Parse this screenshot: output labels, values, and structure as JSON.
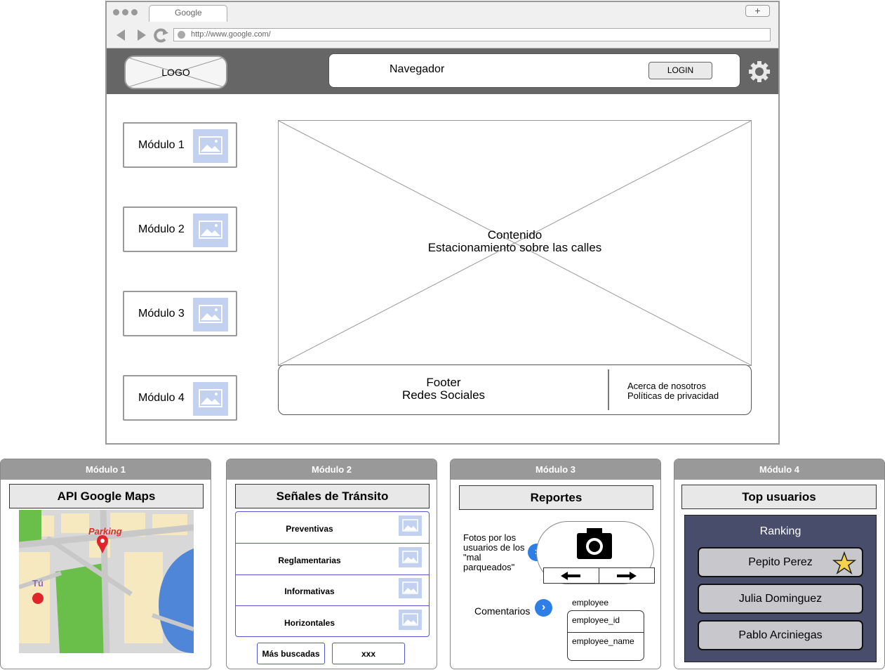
{
  "browser": {
    "tab_title": "Google",
    "new_tab_symbol": "+",
    "url": "http://www.google.com/"
  },
  "header": {
    "logo": "LOGO",
    "nav_label": "Navegador",
    "login_label": "LOGIN"
  },
  "sidebar": {
    "items": [
      {
        "label": "Módulo 1"
      },
      {
        "label": "Módulo 2"
      },
      {
        "label": "Módulo 3"
      },
      {
        "label": "Módulo 4"
      }
    ]
  },
  "content": {
    "line1": "Contenido",
    "line2": "Estacionamiento sobre las calles"
  },
  "footer": {
    "line1": "Footer",
    "line2": "Redes Sociales",
    "link1": "Acerca de nosotros",
    "link2": "Políticas de privacidad"
  },
  "modules": {
    "m1": {
      "title": "Módulo 1",
      "heading": "API Google Maps",
      "parking": "Parking",
      "you": "Tú"
    },
    "m2": {
      "title": "Módulo 2",
      "heading": "Señales de Tránsito",
      "items": [
        "Preventivas",
        "Reglamentarias",
        "Informativas",
        "Horizontales"
      ],
      "btn1": "Más buscadas",
      "btn2": "xxx"
    },
    "m3": {
      "title": "Módulo 3",
      "heading": "Reportes",
      "photos_line1": "Fotos por los",
      "photos_line2": "usuarios de los",
      "photos_line3": "\"mal",
      "photos_line4": "parqueados\"",
      "comments": "Comentarios",
      "table_name": "employee",
      "field1": "employee_id",
      "field2": "employee_name"
    },
    "m4": {
      "title": "Módulo 4",
      "heading": "Top usuarios",
      "ranking": "Ranking",
      "users": [
        "Pepito Perez",
        "Julia Dominguez",
        "Pablo Arciniegas"
      ]
    }
  },
  "colors": {
    "header_bg": "#666666",
    "panel_title_bg": "#999999",
    "image_placeholder": "#c2d1ef",
    "accent_blue": "#2e7ee6",
    "ranking_bg": "#474d6b",
    "map_green": "#6abf4b",
    "map_water": "#4f86d8",
    "map_land": "#f6e9bf",
    "pin_red": "#e0262b"
  },
  "icons": [
    "back-arrow-icon",
    "forward-arrow-icon",
    "reload-icon",
    "gear-icon",
    "image-placeholder-icon",
    "camera-icon",
    "left-arrow-icon",
    "right-arrow-icon",
    "chevron-right-icon",
    "star-icon",
    "map-pin-icon"
  ]
}
